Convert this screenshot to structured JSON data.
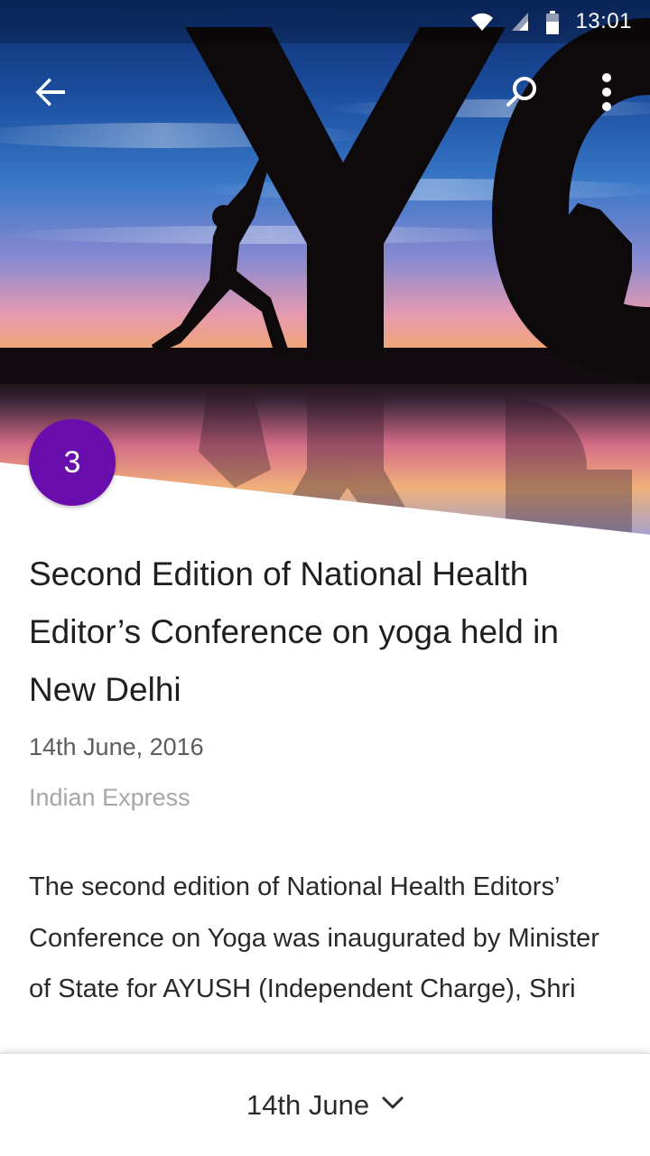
{
  "status_bar": {
    "time": "13:01",
    "icons": [
      "wifi-icon",
      "cell-signal-icon",
      "battery-icon"
    ]
  },
  "app_bar": {
    "icons": [
      "back-arrow-icon",
      "search-icon",
      "more-vert-icon"
    ]
  },
  "hero": {
    "badge_number": "3",
    "badge_color": "#6a0dad"
  },
  "article": {
    "title": "Second Edition of National Health Editor’s Conference on yoga held in New Delhi",
    "date": "14th June, 2016",
    "source": "Indian Express",
    "body": "The second edition of National Health Editors’ Conference on Yoga was inaugurated by Minister of State for AYUSH (Independent Charge), Shri"
  },
  "bottom_bar": {
    "label": "14th June",
    "icon": "chevron-down-icon"
  }
}
